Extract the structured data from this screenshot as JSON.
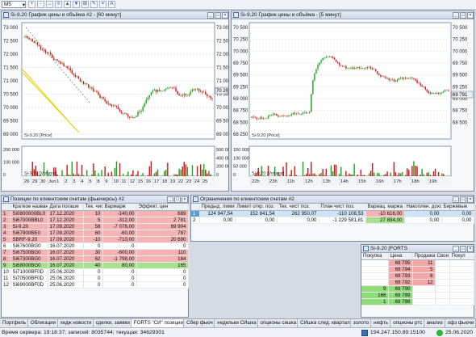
{
  "toolbar": {
    "interval": "M5",
    "buttons": [
      "+",
      "-",
      "↔",
      "≡",
      "▲",
      "▼",
      "⊞",
      "✎",
      "⌖",
      "A"
    ]
  },
  "chart1": {
    "title": "Si-9.20 График цены и объёма #2 - [60 минут]",
    "y_ticks": [
      "73 000",
      "72 500",
      "72 000",
      "71 500",
      "71 000",
      "70 500",
      "70 000",
      "69 500",
      "69 000"
    ],
    "last_price": "70 201",
    "price_label": "Si-9.20 [Price]",
    "vol_ticks": [
      "200 000",
      "100 000",
      "0"
    ],
    "vol_right_ticks": [
      "500 000",
      "400 000",
      "200 000",
      "0"
    ],
    "vol_label": "Si-9.20 [Volume]",
    "dates": [
      "26",
      "29",
      "30",
      "Jun",
      "1",
      "2",
      "3",
      "4",
      "5",
      "8",
      "9",
      "10",
      "11",
      "12",
      "15",
      "16",
      "17",
      "18",
      "19",
      "22",
      "23",
      "24",
      "25"
    ]
  },
  "chart2": {
    "title": "Si-9.20 График цены и объёма - [5 минут]",
    "y_ticks": [
      "70 500",
      "70 250",
      "70 000",
      "69 750",
      "69 500",
      "69 250",
      "69 000",
      "68 750",
      "68 500",
      "68 250"
    ],
    "y_right_ticks": [
      "70 500",
      "70 250",
      "70 000",
      "69 750",
      "69 500",
      "69 250",
      "69 000",
      "68 750",
      "68 500"
    ],
    "last_price": "69 791",
    "price_label": "Si-9.20 [Price]",
    "vol_ticks": [
      "150 000",
      "100 000",
      "50 000",
      "0"
    ],
    "vol_label": "Si-9.20 [Volume]",
    "dates": [
      "22h",
      "23h",
      "11h",
      "12h",
      "13h",
      "14h",
      "15h",
      "16h",
      "17h",
      "18h",
      "19h"
    ]
  },
  "positions": {
    "title": "Позиции по клиентским счетам (фьючерсы) #2",
    "columns": [
      "Краткое названи",
      "Дата погаше",
      "Тек. чист",
      "Вармарж",
      "Эффект. цен"
    ],
    "rows": [
      {
        "n": "1",
        "name": "Si0800000BL0",
        "date": "17.12.2020",
        "qty": "10",
        "varm": "-140,00",
        "price": "689",
        "hl": "red"
      },
      {
        "n": "2",
        "name": "Si67000BBL0",
        "date": "17.12.2020",
        "qty": "5",
        "varm": "-312,00",
        "price": "2 781",
        "hl": "red"
      },
      {
        "n": "3",
        "name": "Si-9.20",
        "date": "17.09.2020",
        "qty": "58",
        "varm": "-7 076,00",
        "price": "69 904",
        "hl": "red"
      },
      {
        "n": "4",
        "name": "Si67900BE0",
        "date": "17.09.2020",
        "qty": "60",
        "varm": "-60,00",
        "price": "787",
        "hl": "red"
      },
      {
        "n": "5",
        "name": "SBRF-9.20",
        "date": "17.09.2020",
        "qty": "-10",
        "varm": "-710,00",
        "price": "20 690",
        "hl": "red"
      },
      {
        "n": "6",
        "name": "Si67600BG0",
        "date": "16.07.2020",
        "qty": "0",
        "varm": "0",
        "price": "0",
        "hl": ""
      },
      {
        "n": "7",
        "name": "Si67500BG0",
        "date": "16.07.2020",
        "qty": "30",
        "varm": "-600,00",
        "price": "110",
        "hl": "red"
      },
      {
        "n": "8",
        "name": "Si67300BG0",
        "date": "16.07.2020",
        "qty": "62",
        "varm": "-1 798,00",
        "price": "184",
        "hl": "red"
      },
      {
        "n": "9",
        "name": "Si68000BG0",
        "date": "16.07.2020",
        "qty": "40",
        "varm": "80,00",
        "price": "165",
        "hl": "green"
      },
      {
        "n": "10",
        "name": "Si71000BF0D",
        "date": "25.06.2020",
        "qty": "0",
        "varm": "0",
        "price": "0",
        "hl": ""
      },
      {
        "n": "11",
        "name": "Si70500BF0D",
        "date": "25.06.2020",
        "qty": "0",
        "varm": "0",
        "price": "0",
        "hl": ""
      },
      {
        "n": "12",
        "name": "Si69000BF0D",
        "date": "25.06.2020",
        "qty": "0",
        "varm": "0",
        "price": "0",
        "hl": ""
      }
    ]
  },
  "limits": {
    "title": "Ограничения по клиентским счетам #2",
    "columns": [
      "Предыд. лимит",
      "Лимит откр. поз.",
      "Тек. чист поз.",
      "План чист поз.",
      "Вариац. маржа",
      "Накоплен. доход",
      "Биржевые"
    ],
    "rows": [
      {
        "n": "1",
        "cells": [
          "124 947,54",
          "152 841,54",
          "262 950,07",
          "-110 108,53",
          "-10 616,00",
          "0,00",
          "0,00"
        ],
        "hl": "red"
      },
      {
        "n": "2",
        "cells": [
          "0,00",
          "0,00",
          "0,00",
          "-1 229 581,81",
          "27 894,00",
          "0,00",
          "0,00"
        ],
        "hl": "green"
      }
    ]
  },
  "orderbook": {
    "title": "Si-9.20 [FORTS",
    "columns": [
      "Покупка",
      "Цена",
      "Продажа",
      "Свои",
      "Покуп"
    ],
    "rows": [
      {
        "buy": "",
        "price": "69 795",
        "sell": "11",
        "side": "ask"
      },
      {
        "buy": "",
        "price": "69 794",
        "sell": "5",
        "side": "ask"
      },
      {
        "buy": "",
        "price": "69 793",
        "sell": "6",
        "side": "ask"
      },
      {
        "buy": "",
        "price": "69 792",
        "sell": "12",
        "side": "ask"
      },
      {
        "buy": "9",
        "price": "69 790",
        "sell": "",
        "side": "bid"
      },
      {
        "buy": "166",
        "price": "69 789",
        "sell": "",
        "side": "bid"
      },
      {
        "buy": "1",
        "price": "69 788",
        "sell": "",
        "side": "bid"
      }
    ]
  },
  "tabs": [
    "Портфель",
    "Облигации",
    "хедж новости",
    "сделки, заявки",
    "FORTS \"СИ\" позиции",
    "Сбер фьюч",
    "недельки СИшка",
    "опционы сишка",
    "СИшка след. квартал",
    "золото",
    "нефть",
    "опционы ртс",
    "анализ",
    "офз фьючи"
  ],
  "active_tab": 4,
  "status": {
    "server_time": "Время сервера: 19:18:37; записей: 8035744; текущая: 34629301",
    "connection": "194.247.150.89:15100",
    "date": "25.06.2020"
  },
  "colors": {
    "ask": "#f4a7a7",
    "bid": "#8fdc7a",
    "red_row": "#f6b3b3",
    "green_row": "#a8e08f",
    "up_candle": "#1ea51e",
    "down_candle": "#d01818"
  }
}
